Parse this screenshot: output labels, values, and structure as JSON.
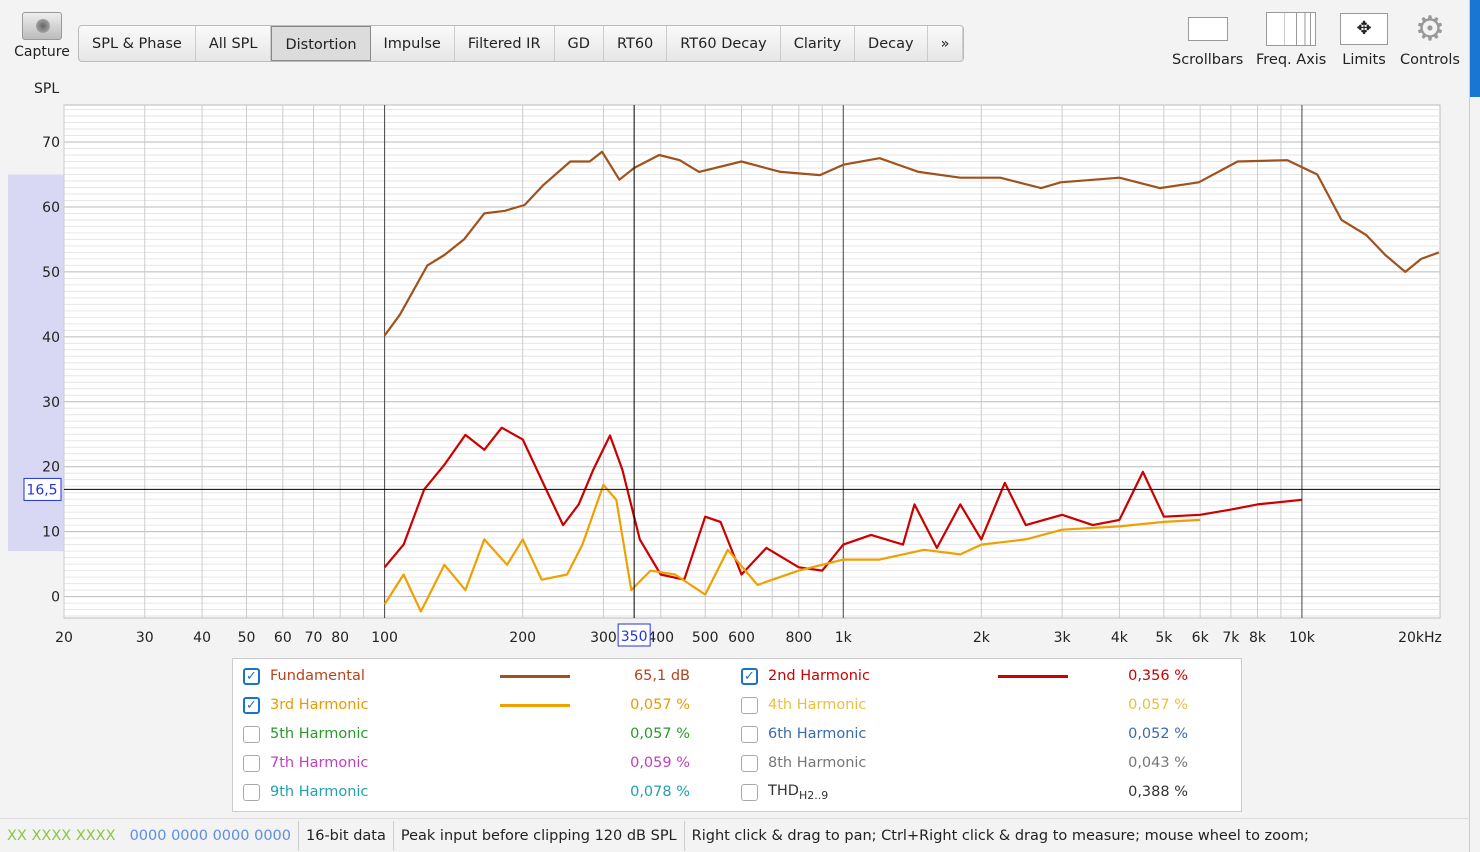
{
  "toolbar": {
    "capture": "Capture",
    "tabs": [
      "SPL & Phase",
      "All SPL",
      "Distortion",
      "Impulse",
      "Filtered IR",
      "GD",
      "RT60",
      "RT60 Decay",
      "Clarity",
      "Decay",
      "»"
    ],
    "active_tab": "Distortion",
    "tools": [
      "Scrollbars",
      "Freq. Axis",
      "Limits",
      "Controls"
    ]
  },
  "chart_data": {
    "type": "line",
    "ylabel": "SPL",
    "xscale": "log",
    "xlim": [
      20,
      20000
    ],
    "ylim": [
      -3.3,
      75.7
    ],
    "yticks": [
      0,
      10,
      20,
      30,
      40,
      50,
      60,
      70
    ],
    "xticks": [
      {
        "v": 20,
        "l": "20"
      },
      {
        "v": 30,
        "l": "30"
      },
      {
        "v": 40,
        "l": "40"
      },
      {
        "v": 50,
        "l": "50"
      },
      {
        "v": 60,
        "l": "60"
      },
      {
        "v": 70,
        "l": "70"
      },
      {
        "v": 80,
        "l": "80"
      },
      {
        "v": 100,
        "l": "100"
      },
      {
        "v": 200,
        "l": "200"
      },
      {
        "v": 300,
        "l": "300"
      },
      {
        "v": 400,
        "l": "400"
      },
      {
        "v": 500,
        "l": "500"
      },
      {
        "v": 600,
        "l": "600"
      },
      {
        "v": 800,
        "l": "800"
      },
      {
        "v": 1000,
        "l": "1k"
      },
      {
        "v": 2000,
        "l": "2k"
      },
      {
        "v": 3000,
        "l": "3k"
      },
      {
        "v": 4000,
        "l": "4k"
      },
      {
        "v": 5000,
        "l": "5k"
      },
      {
        "v": 6000,
        "l": "6k"
      },
      {
        "v": 7000,
        "l": "7k"
      },
      {
        "v": 8000,
        "l": "8k"
      },
      {
        "v": 10000,
        "l": "10k"
      },
      {
        "v": 20000,
        "l": "20kHz"
      }
    ],
    "cursor": {
      "x": 350,
      "x_label": "350",
      "y": 16.5,
      "y_label": "16,5"
    },
    "series": [
      {
        "name": "Fundamental",
        "color": "#a0521d",
        "x": [
          100,
          108,
          124,
          135,
          149,
          165,
          183,
          202,
          222,
          254,
          280,
          298,
          325,
          350,
          397,
          440,
          485,
          600,
          730,
          890,
          1000,
          1200,
          1460,
          1800,
          2200,
          2700,
          2980,
          4000,
          4900,
          5960,
          7240,
          9300,
          10800,
          12200,
          13800,
          15200,
          16800,
          18200,
          19900
        ],
        "y": [
          40.2,
          43.4,
          51,
          52.6,
          55,
          59,
          59.4,
          60.3,
          63.4,
          67,
          67,
          68.5,
          64.2,
          66,
          68,
          67.2,
          65.4,
          67,
          65.4,
          64.9,
          66.5,
          67.5,
          65.4,
          64.5,
          64.5,
          62.9,
          63.8,
          64.5,
          62.9,
          63.8,
          67,
          67.2,
          65,
          58,
          55.7,
          52.6,
          50,
          52,
          53
        ]
      },
      {
        "name": "2nd Harmonic",
        "color": "#cc0000",
        "x": [
          100,
          110,
          122,
          135,
          150,
          165,
          180,
          200,
          225,
          245,
          265,
          285,
          310,
          330,
          360,
          400,
          450,
          500,
          540,
          600,
          680,
          800,
          900,
          1000,
          1150,
          1350,
          1430,
          1600,
          1800,
          2000,
          2250,
          2500,
          3000,
          3500,
          4000,
          4500,
          5000,
          6000,
          7000,
          8000,
          10000
        ],
        "y": [
          4.5,
          8,
          16.5,
          20.3,
          24.9,
          22.6,
          26,
          24.2,
          16.5,
          11,
          14.2,
          19.5,
          24.8,
          19.5,
          8.8,
          3.4,
          2.6,
          12.3,
          11.5,
          3.4,
          7.5,
          4.5,
          4,
          8,
          9.5,
          8,
          14.2,
          7.5,
          14.2,
          8.8,
          17.5,
          11,
          12.6,
          11,
          11.8,
          19.2,
          12.3,
          12.6,
          13.4,
          14.2,
          14.9
        ]
      },
      {
        "name": "3rd Harmonic",
        "color": "#f0a000",
        "x": [
          100,
          110,
          120,
          135,
          150,
          165,
          185,
          200,
          220,
          250,
          270,
          300,
          320,
          345,
          380,
          430,
          500,
          560,
          650,
          800,
          1000,
          1200,
          1500,
          1800,
          2000,
          2500,
          3000,
          4000,
          5000,
          6000
        ],
        "y": [
          -1.2,
          3.4,
          -2.3,
          4.9,
          1,
          8.8,
          4.9,
          8.8,
          2.6,
          3.4,
          8,
          17.2,
          14.9,
          1,
          4,
          3.4,
          0.3,
          7.2,
          1.8,
          4,
          5.7,
          5.7,
          7.2,
          6.5,
          8,
          8.8,
          10.3,
          10.8,
          11.5,
          11.8
        ]
      }
    ]
  },
  "legend": [
    {
      "name": "Fundamental",
      "checked": true,
      "color": "#b5441a",
      "line": "#a0521d",
      "value": "65,1 dB"
    },
    {
      "name": "2nd Harmonic",
      "checked": true,
      "color": "#cc0000",
      "line": "#cc0000",
      "value": "0,356 %"
    },
    {
      "name": "3rd Harmonic",
      "checked": true,
      "color": "#e89a00",
      "line": "#f0a000",
      "value": "0,057 %"
    },
    {
      "name": "4th Harmonic",
      "checked": false,
      "color": "#e8c040",
      "value": "0,057 %"
    },
    {
      "name": "5th Harmonic",
      "checked": false,
      "color": "#2a9a2a",
      "value": "0,057 %"
    },
    {
      "name": "6th Harmonic",
      "checked": false,
      "color": "#3a6ab0",
      "value": "0,052 %"
    },
    {
      "name": "7th Harmonic",
      "checked": false,
      "color": "#c040c0",
      "value": "0,059 %"
    },
    {
      "name": "8th Harmonic",
      "checked": false,
      "color": "#777777",
      "value": "0,043 %"
    },
    {
      "name": "9th Harmonic",
      "checked": false,
      "color": "#20a0b0",
      "value": "0,078 %"
    },
    {
      "name": "THD",
      "sub": "H2..9",
      "checked": false,
      "color": "#333333",
      "value": "0,388 %"
    }
  ],
  "status": {
    "levels_green": "XX  XXXX XXXX",
    "levels_blue": "0000 0000  0000 0000",
    "bits": "16-bit data",
    "peak": "Peak input before clipping 120 dB SPL",
    "hint": "Right click & drag to pan; Ctrl+Right click & drag to measure; mouse wheel to zoom;"
  }
}
